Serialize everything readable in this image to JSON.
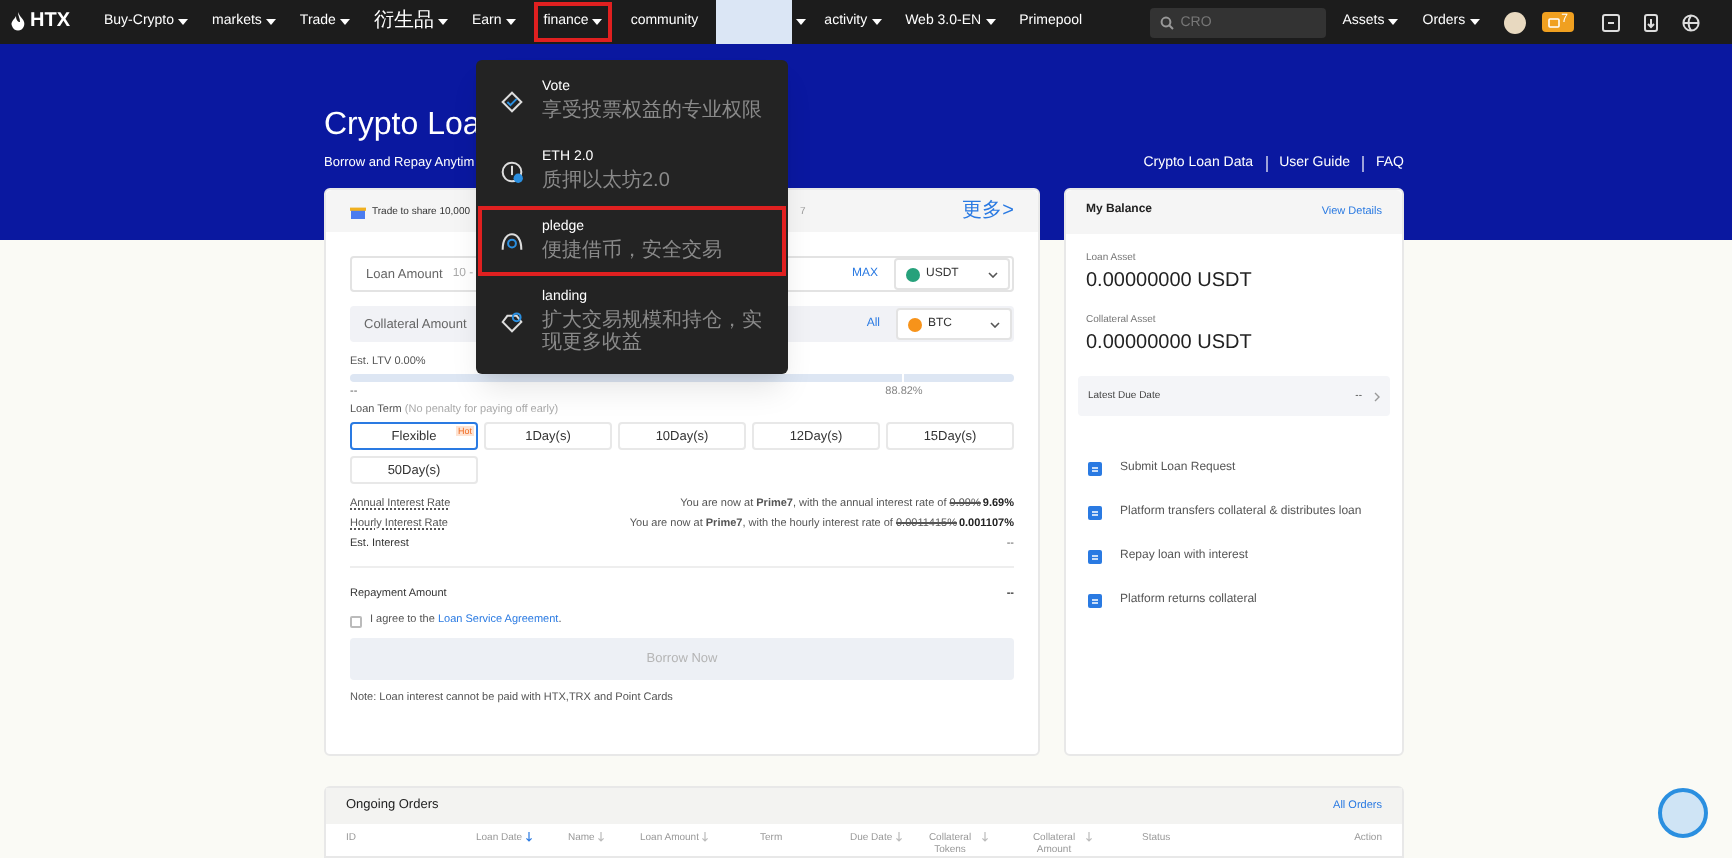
{
  "nav": {
    "logo": "HTX",
    "items": [
      {
        "label": "Buy-Crypto",
        "caret": true,
        "selected": false,
        "cjk": false
      },
      {
        "label": "markets",
        "caret": true,
        "selected": false,
        "cjk": false
      },
      {
        "label": "Trade",
        "caret": true,
        "selected": false,
        "cjk": false
      },
      {
        "label": "衍生品",
        "caret": true,
        "selected": false,
        "cjk": true
      },
      {
        "label": "Earn",
        "caret": true,
        "selected": false,
        "cjk": false
      },
      {
        "label": "finance",
        "caret": true,
        "selected": true,
        "cjk": false
      },
      {
        "label": "community",
        "caret": true,
        "selected": false,
        "cjk": false,
        "mascot": true
      },
      {
        "label": "activity",
        "caret": true,
        "selected": false,
        "cjk": false
      },
      {
        "label": "Web 3.0-EN",
        "caret": true,
        "selected": false,
        "cjk": false
      },
      {
        "label": "Primepool",
        "caret": false,
        "selected": false,
        "cjk": false
      }
    ],
    "search": {
      "placeholder": "CRO"
    },
    "right_items": [
      {
        "label": "Assets"
      },
      {
        "label": "Orders"
      }
    ],
    "badge": "7"
  },
  "dropdown": {
    "items": [
      {
        "kind": "vote",
        "title": "Vote",
        "subtitle": "享受投票权益的专业权限",
        "selected": false
      },
      {
        "kind": "eth",
        "title": "ETH 2.0",
        "subtitle": "质押以太坊2.0",
        "selected": false
      },
      {
        "kind": "pledge",
        "title": "pledge",
        "subtitle": "便捷借币，安全交易",
        "selected": true
      },
      {
        "kind": "landing",
        "title": "landing",
        "subtitle": "扩大交易规模和持仓，实现更多收益",
        "selected": false
      }
    ]
  },
  "hero": {
    "title": "Crypto Loa",
    "subtitle": "Borrow and Repay Anytim",
    "links": [
      "Crypto Loan Data",
      "User Guide",
      "FAQ"
    ]
  },
  "loan_card": {
    "banner": {
      "text": "Trade to share 10,000",
      "tail": "7",
      "more": "更多>"
    },
    "fields": [
      {
        "label": "Loan Amount",
        "placeholder": "10 -",
        "action": "MAX",
        "asset": "USDT",
        "color": "#26a17b",
        "filled": false
      },
      {
        "label": "Collateral Amount",
        "action": "All",
        "asset": "BTC",
        "color": "#f7931a",
        "filled": true
      }
    ],
    "ltv": {
      "label": "Est. LTV 0.00%",
      "left": "--",
      "marker": "88.82%"
    },
    "term": {
      "label": "Loan Term",
      "hint": "(No penalty for paying off early)",
      "options": [
        {
          "label": "Flexible",
          "selected": true,
          "badge": "Hot"
        },
        {
          "label": "1Day(s)",
          "selected": false
        },
        {
          "label": "10Day(s)",
          "selected": false
        },
        {
          "label": "12Day(s)",
          "selected": false
        },
        {
          "label": "15Day(s)",
          "selected": false
        },
        {
          "label": "50Day(s)",
          "selected": false
        }
      ]
    },
    "rates": [
      {
        "label": "Annual Interest Rate",
        "text": "You are now at **Prime7**, with the annual interest rate of",
        "old": "9.99%",
        "new": "9.69%"
      },
      {
        "label": "Hourly Interest Rate",
        "text": "You are now at **Prime7**, with the hourly interest rate of",
        "old": "0.0011415%",
        "new": "0.001107%"
      }
    ],
    "est_interest": {
      "label": "Est. Interest",
      "value": "--"
    },
    "repayment": {
      "label": "Repayment Amount",
      "value": "--"
    },
    "agreement": {
      "text": "I agree to the",
      "link": "Loan Service Agreement",
      "tail": ".",
      "checked": false
    },
    "submit": {
      "label": "Borrow Now",
      "disabled": true
    },
    "note": "Note: Loan interest cannot be paid with HTX,TRX and Point Cards"
  },
  "balance": {
    "title": "My Balance",
    "link": "View Details",
    "assets": [
      {
        "label": "Loan Asset",
        "value": "0.00000000 USDT"
      },
      {
        "label": "Collateral Asset",
        "value": "0.00000000 USDT"
      }
    ],
    "due": {
      "label": "Latest Due Date",
      "value": "--"
    },
    "steps": [
      {
        "text": "Submit Loan Request"
      },
      {
        "text": "Platform transfers collateral & distributes loan"
      },
      {
        "text": "Repay loan with interest"
      },
      {
        "text": "Platform returns collateral"
      }
    ]
  },
  "orders": {
    "title": "Ongoing Orders",
    "link": "All Orders",
    "columns": [
      {
        "label": "ID",
        "sortable": false
      },
      {
        "label": "Loan Date",
        "sortable": true,
        "sorted": true
      },
      {
        "label": "Name",
        "sortable": true,
        "sorted": false
      },
      {
        "label": "Loan Amount",
        "sortable": true,
        "sorted": false
      },
      {
        "label": "Term",
        "sortable": false
      },
      {
        "label": "Due Date",
        "sortable": true,
        "sorted": false
      },
      {
        "label": "Collateral Tokens",
        "sortable": true,
        "sorted": false
      },
      {
        "label": "Collateral Amount",
        "sortable": true,
        "sorted": false
      },
      {
        "label": "Status",
        "sortable": false
      },
      {
        "label": "Action",
        "sortable": false
      }
    ]
  }
}
